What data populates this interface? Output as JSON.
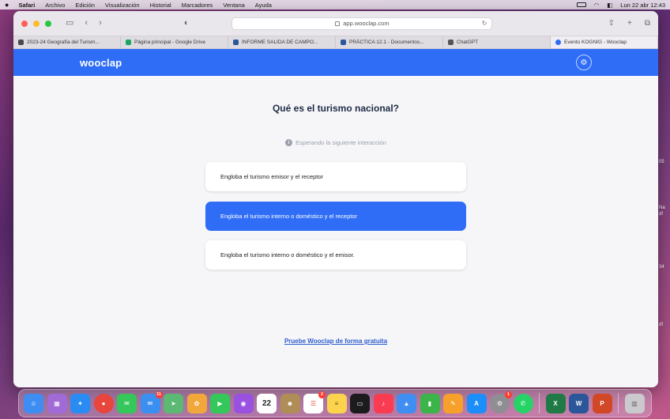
{
  "menubar": {
    "app": "Safari",
    "items": [
      "Archivo",
      "Edición",
      "Visualización",
      "Historial",
      "Marcadores",
      "Ventana",
      "Ayuda"
    ],
    "clock": "Lun 22 abr  12:43"
  },
  "desktop_fragments": [
    "05",
    "Na",
    "df",
    "34",
    "df"
  ],
  "browser": {
    "url": "app.wooclap.com",
    "tabs": [
      {
        "label": "2023-24 Geografía del Turism...",
        "color": "#4a4a4a"
      },
      {
        "label": "Página principal - Google Drive",
        "color": "#1fa463"
      },
      {
        "label": "INFORME SALIDA DE CAMPO...",
        "color": "#2b579a"
      },
      {
        "label": "PRÁCTICA 12.1 - Documentos...",
        "color": "#2b579a"
      },
      {
        "label": "ChatGPT",
        "color": "#555555"
      },
      {
        "label": "Evento KOGNIG - Wooclap",
        "color": "#2f6df6"
      }
    ]
  },
  "wooclap": {
    "logo": "wooclap",
    "question": "Qué es el turismo nacional?",
    "waiting": "Esperando la siguiente interacción",
    "options": [
      {
        "text": "Engloba el turismo emisor y el receptor",
        "selected": false
      },
      {
        "text": "Engloba el turismo interno o doméstico y el receptor",
        "selected": true
      },
      {
        "text": "Engloba el turismo interno o doméstico y el emisor.",
        "selected": false
      }
    ],
    "try_link": "Pruebe Wooclap de forma gratuita",
    "accent": "#2f6df6"
  },
  "dock": {
    "calendar_day": "22",
    "apps": [
      {
        "name": "finder",
        "color": "#3d8df2",
        "badge": ""
      },
      {
        "name": "launchpad",
        "color": "#a06ad7",
        "badge": ""
      },
      {
        "name": "safari",
        "color": "#2a8cf3",
        "badge": ""
      },
      {
        "name": "chrome",
        "color": "#e8453c",
        "badge": ""
      },
      {
        "name": "messages",
        "color": "#35c759",
        "badge": ""
      },
      {
        "name": "mail",
        "color": "#3b8ff0",
        "badge": "11"
      },
      {
        "name": "maps",
        "color": "#5bb974",
        "badge": ""
      },
      {
        "name": "photos",
        "color": "#f2a73a",
        "badge": ""
      },
      {
        "name": "facetime",
        "color": "#34c759",
        "badge": ""
      },
      {
        "name": "podcasts",
        "color": "#9b51e0",
        "badge": ""
      },
      {
        "name": "calendar",
        "color": "#ffffff",
        "badge": ""
      },
      {
        "name": "contacts",
        "color": "#b08d57",
        "badge": ""
      },
      {
        "name": "reminders",
        "color": "#ffffff",
        "badge": "2"
      },
      {
        "name": "notes",
        "color": "#fcd34d",
        "badge": ""
      },
      {
        "name": "tv",
        "color": "#1c1c1e",
        "badge": ""
      },
      {
        "name": "music",
        "color": "#fa3c52",
        "badge": ""
      },
      {
        "name": "keynote",
        "color": "#3f8ef1",
        "badge": ""
      },
      {
        "name": "numbers",
        "color": "#3bb54a",
        "badge": ""
      },
      {
        "name": "pages",
        "color": "#f7a02c",
        "badge": ""
      },
      {
        "name": "app-store",
        "color": "#1c8ef9",
        "badge": ""
      },
      {
        "name": "system-settings",
        "color": "#8e8e93",
        "badge": "1"
      },
      {
        "name": "whatsapp",
        "color": "#25d366",
        "badge": ""
      },
      {
        "name": "excel",
        "color": "#1f7a45",
        "badge": ""
      },
      {
        "name": "word",
        "color": "#2b579a",
        "badge": ""
      },
      {
        "name": "powerpoint",
        "color": "#d24726",
        "badge": ""
      },
      {
        "name": "trash",
        "color": "#c9c9ce",
        "badge": ""
      }
    ]
  }
}
